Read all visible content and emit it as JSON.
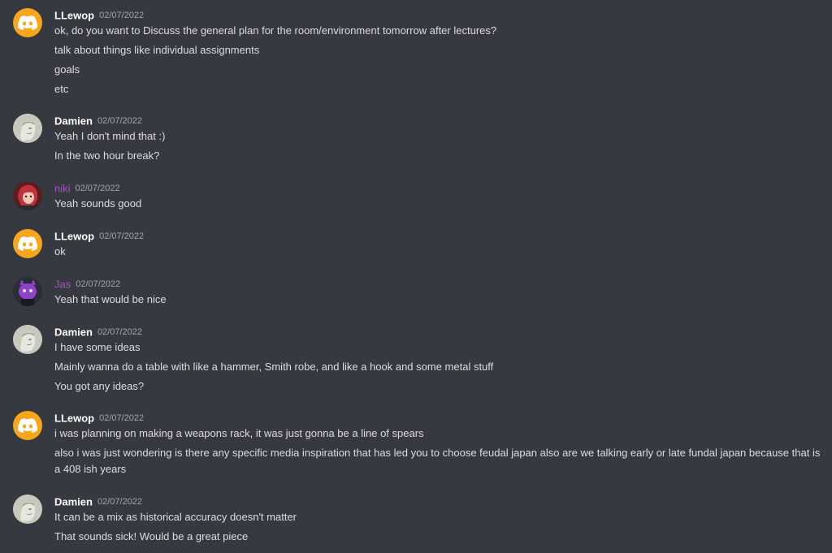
{
  "colors": {
    "background": "#36393f",
    "text": "#dcddde",
    "username_default": "#ffffff",
    "username_role_purple": "#9b59b6",
    "timestamp": "#a3a6aa",
    "discord_avatar": "#faa61a"
  },
  "messages": [
    {
      "author": "LLewop",
      "avatar": "discord-logo-avatar",
      "timestamp": "02/07/2022",
      "lines": [
        "ok, do you want to Discuss the general plan for the room/environment tomorrow after lectures?",
        "talk about things like individual assignments",
        "goals",
        "etc"
      ]
    },
    {
      "author": "Damien",
      "avatar": "damien-avatar",
      "timestamp": "02/07/2022",
      "lines": [
        "Yeah I don't mind that :)",
        "In the two hour break?"
      ]
    },
    {
      "author": "niki",
      "avatar": "niki-avatar",
      "timestamp": "02/07/2022",
      "lines": [
        "Yeah sounds good"
      ]
    },
    {
      "author": "LLewop",
      "avatar": "discord-logo-avatar",
      "timestamp": "02/07/2022",
      "lines": [
        "ok"
      ]
    },
    {
      "author": "Jas",
      "avatar": "jas-avatar",
      "timestamp": "02/07/2022",
      "lines": [
        "Yeah that would be nice"
      ]
    },
    {
      "author": "Damien",
      "avatar": "damien-avatar",
      "timestamp": "02/07/2022",
      "lines": [
        "I have some ideas",
        "Mainly wanna do a table with like a hammer, Smith robe, and like a hook and some metal stuff",
        "You got any ideas?"
      ]
    },
    {
      "author": "LLewop",
      "avatar": "discord-logo-avatar",
      "timestamp": "02/07/2022",
      "lines": [
        "i was planning on making a weapons rack, it was just gonna be a line of spears",
        "also i was just wondering is there any specific media inspiration that has led you to choose feudal japan also are we talking early or late fundal japan because that is a 408 ish years"
      ]
    },
    {
      "author": "Damien",
      "avatar": "damien-avatar",
      "timestamp": "02/07/2022",
      "lines": [
        "It can be a mix as historical accuracy doesn't matter",
        "That sounds sick! Would be a great piece"
      ]
    }
  ]
}
